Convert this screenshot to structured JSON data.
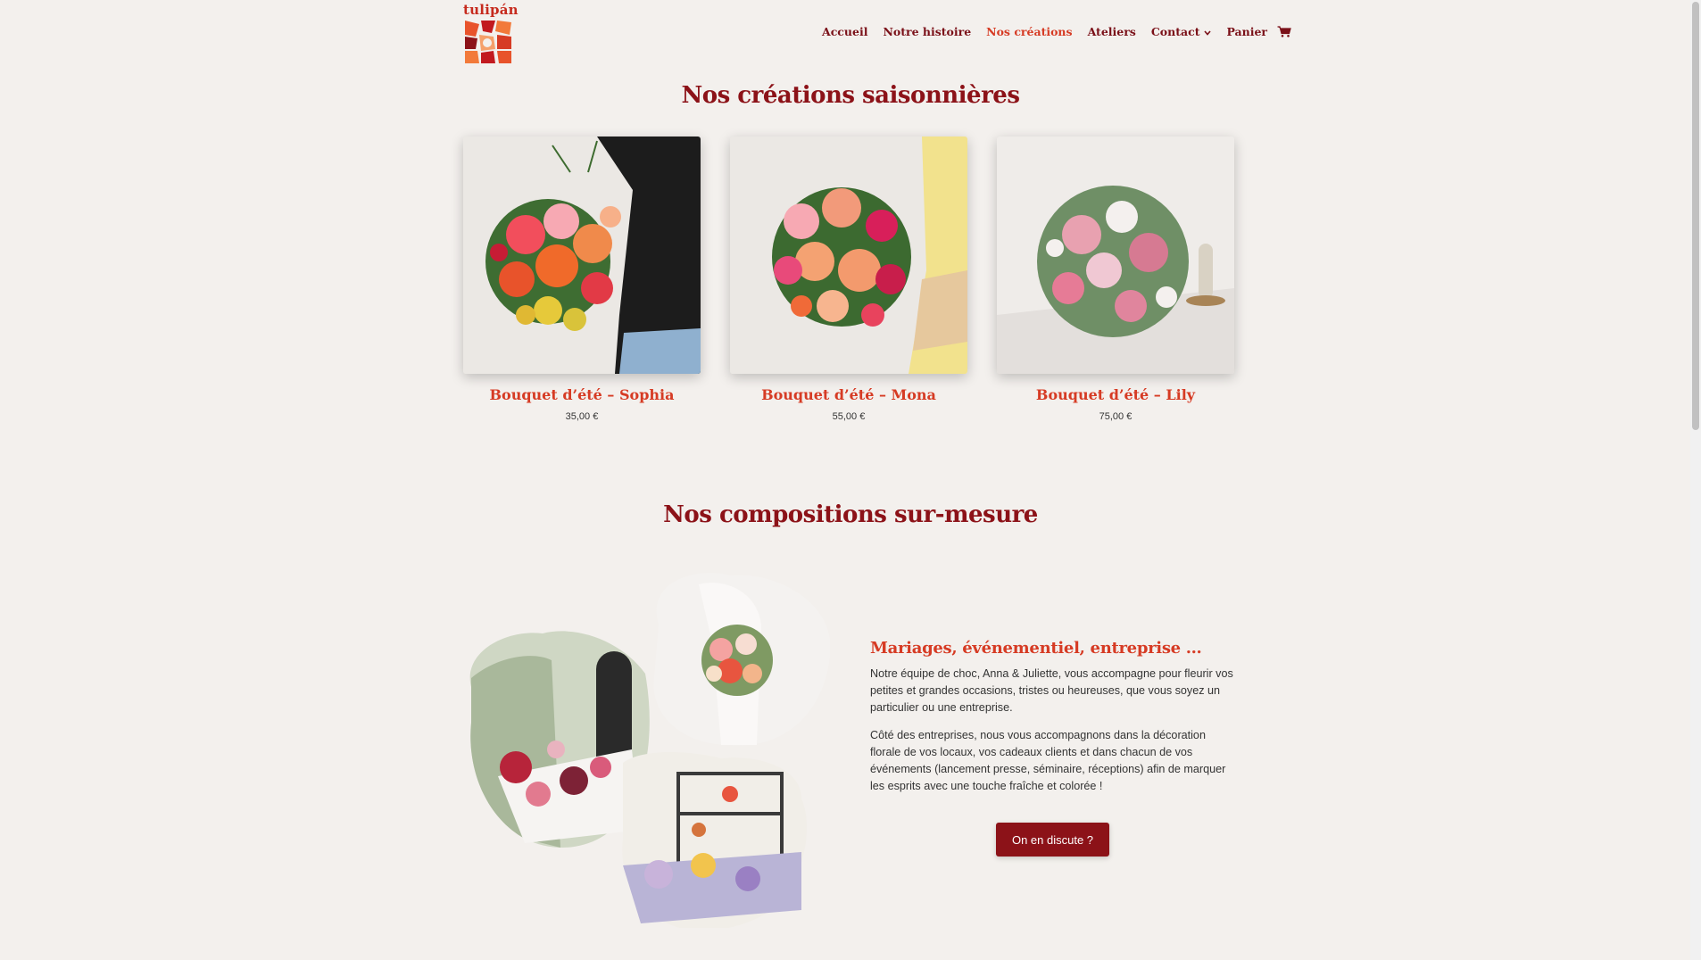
{
  "brand": {
    "logo_text": "tulipán",
    "accent": "#d63b24",
    "dark": "#8c1218"
  },
  "nav": {
    "items": [
      {
        "label": "Accueil"
      },
      {
        "label": "Notre histoire"
      },
      {
        "label": "Nos créations",
        "active": true
      },
      {
        "label": "Ateliers"
      },
      {
        "label": "Contact",
        "has_dropdown": true
      },
      {
        "label": "Panier"
      }
    ],
    "cart_icon": "cart-icon"
  },
  "creations": {
    "title": "Nos créations saisonnières",
    "products": [
      {
        "name": "Bouquet d’été – Sophia",
        "price": "35,00 €"
      },
      {
        "name": "Bouquet d’été – Mona",
        "price": "55,00 €"
      },
      {
        "name": "Bouquet d’été – Lily",
        "price": "75,00 €"
      }
    ]
  },
  "compositions": {
    "title": "Nos compositions sur-mesure",
    "heading": "Mariages, événementiel, entreprise …",
    "paragraph1": "Notre équipe de choc, Anna & Juliette, vous accompagne pour fleurir vos petites et grandes occasions, tristes ou heureuses, que vous soyez un particulier ou une entreprise.",
    "paragraph2": "Côté des entreprises, nous vous accompagnons dans la décoration florale de vos locaux, vos cadeaux clients et dans chacun de vos événements (lancement presse, séminaire, réceptions)  afin de marquer les esprits avec une touche fraîche et colorée !",
    "cta_label": "On en discute ?"
  }
}
